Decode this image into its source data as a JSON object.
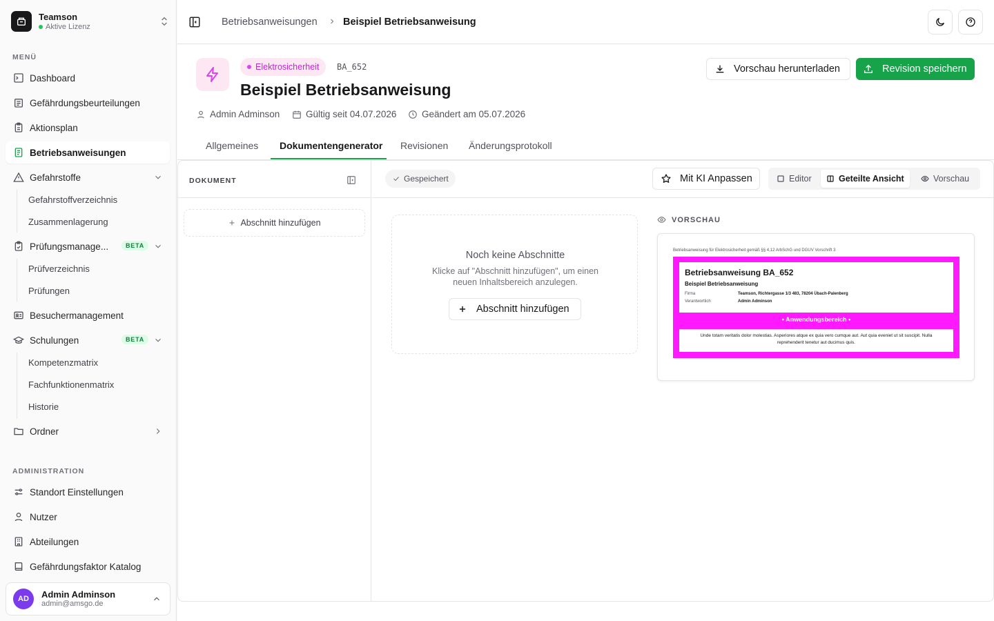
{
  "org": {
    "name": "Teamson",
    "license": "Aktive Lizenz"
  },
  "sidebar": {
    "menu_label": "MENÜ",
    "items": [
      {
        "label": "Dashboard",
        "icon": "dashboard-icon"
      },
      {
        "label": "Gefährdungsbeurteilungen",
        "icon": "clipboard-icon"
      },
      {
        "label": "Aktionsplan",
        "icon": "clipboard-list-icon"
      },
      {
        "label": "Betriebsanweisungen",
        "icon": "file-text-icon",
        "active": true
      },
      {
        "label": "Gefahrstoffe",
        "icon": "warning-icon",
        "expanded": true
      },
      {
        "label": "Prüfungsmanage...",
        "icon": "clipboard-check-icon",
        "badge": "BETA"
      },
      {
        "label": "Besuchermanagement",
        "icon": "id-card-icon"
      },
      {
        "label": "Schulungen",
        "icon": "graduation-cap-icon",
        "badge": "BETA"
      },
      {
        "label": "Ordner",
        "icon": "folder-icon"
      }
    ],
    "gefahrstoffe_sub": [
      "Gefahrstoffverzeichnis",
      "Zusammenlagerung"
    ],
    "pruefung_sub": [
      "Prüfverzeichnis",
      "Prüfungen"
    ],
    "schulungen_sub": [
      "Kompetenzmatrix",
      "Fachfunktionenmatrix",
      "Historie"
    ],
    "admin_label": "ADMINISTRATION",
    "admin_items": [
      {
        "label": "Standort Einstellungen",
        "icon": "sliders-icon"
      },
      {
        "label": "Nutzer",
        "icon": "user-icon"
      },
      {
        "label": "Abteilungen",
        "icon": "building-icon"
      },
      {
        "label": "Gefährdungsfaktor Katalog",
        "icon": "book-icon"
      }
    ]
  },
  "user": {
    "initials": "AD",
    "name": "Admin Adminson",
    "email": "admin@amsgo.de",
    "avatar_color": "#7c3aed"
  },
  "breadcrumb": {
    "parent": "Betriebsanweisungen",
    "current": "Beispiel Betriebsanweisung"
  },
  "header": {
    "category": "Elektrosicherheit",
    "code": "BA_652",
    "title": "Beispiel Betriebsanweisung",
    "author": "Admin Adminson",
    "valid_since": "Gültig seit 04.07.2026",
    "changed_at": "Geändert am 05.07.2026",
    "download_label": "Vorschau herunterladen",
    "save_label": "Revision speichern",
    "accent": "#16a34a",
    "category_color": "#d946ef"
  },
  "tabs": [
    "Allgemeines",
    "Dokumentengenerator",
    "Revisionen",
    "Änderungsprotokoll"
  ],
  "active_tab": "Dokumentengenerator",
  "document_panel": {
    "title": "DOKUMENT",
    "add_section": "Abschnitt hinzufügen"
  },
  "toolbar": {
    "saved": "Gespeichert",
    "ki_label": "Mit KI Anpassen",
    "views": [
      "Editor",
      "Geteilte Ansicht",
      "Vorschau"
    ],
    "active_view": "Geteilte Ansicht"
  },
  "empty_state": {
    "title": "Noch keine Abschnitte",
    "text": "Klicke auf \"Abschnitt hinzufügen\", um einen neuen Inhaltsbereich anzulegen.",
    "button": "Abschnitt hinzufügen"
  },
  "preview": {
    "label": "VORSCHAU",
    "header_line": "Betriebsanweisung für Elektrosicherheit gemäß §§ 4,12 ArbSchG und DGUV Vorschrift 3",
    "title": "Betriebsanweisung BA_652",
    "subtitle": "Beispiel Betriebsanweisung",
    "firma_label": "Firma",
    "firma_value": "Teamson, Richtergasse 1/3 483, 78204 Übach-Palenberg",
    "verantwortlich_label": "Verantwortlich",
    "verantwortlich_value": "Admin Adminson",
    "section_title": "• Anwendungsbereich •",
    "section_text": "Unde totam veritatis dolor molestias. Asperiores atque ex quia vero cumque aut. Aut quia eveniet ut sit suscipit. Nulla reprehenderit tenetur aut ducimus quis.",
    "frame_color": "#ff19ff"
  }
}
